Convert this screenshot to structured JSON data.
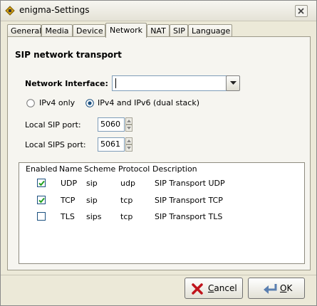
{
  "window": {
    "title": "enigma-Settings"
  },
  "tabs": [
    {
      "label": "General"
    },
    {
      "label": "Media"
    },
    {
      "label": "Device"
    },
    {
      "label": "Network"
    },
    {
      "label": "NAT"
    },
    {
      "label": "SIP"
    },
    {
      "label": "Language"
    }
  ],
  "active_tab": "Network",
  "section": {
    "title": "SIP network transport"
  },
  "network_interface": {
    "label": "Network Interface:",
    "value": ""
  },
  "ip_mode": {
    "options": [
      {
        "label": "IPv4 only",
        "selected": false
      },
      {
        "label": "IPv4 and IPv6 (dual stack)",
        "selected": true
      }
    ]
  },
  "local_sip_port": {
    "label": "Local SIP port:",
    "value": "5060"
  },
  "local_sips_port": {
    "label": "Local SIPS port:",
    "value": "5061"
  },
  "transport_table": {
    "columns": [
      "Enabled",
      "Name",
      "Scheme",
      "Protocol",
      "Description"
    ],
    "rows": [
      {
        "enabled": true,
        "name": "UDP",
        "scheme": "sip",
        "protocol": "udp",
        "description": "SIP Transport UDP"
      },
      {
        "enabled": true,
        "name": "TCP",
        "scheme": "sip",
        "protocol": "tcp",
        "description": "SIP Transport TCP"
      },
      {
        "enabled": false,
        "name": "TLS",
        "scheme": "sips",
        "protocol": "tcp",
        "description": "SIP Transport TLS"
      }
    ]
  },
  "buttons": {
    "cancel": {
      "first": "C",
      "rest": "ancel"
    },
    "ok": {
      "first": "O",
      "rest": "K"
    }
  },
  "colors": {
    "accent": "#1c5180",
    "check": "#21a121",
    "cancel_icon": "#c0141c"
  }
}
